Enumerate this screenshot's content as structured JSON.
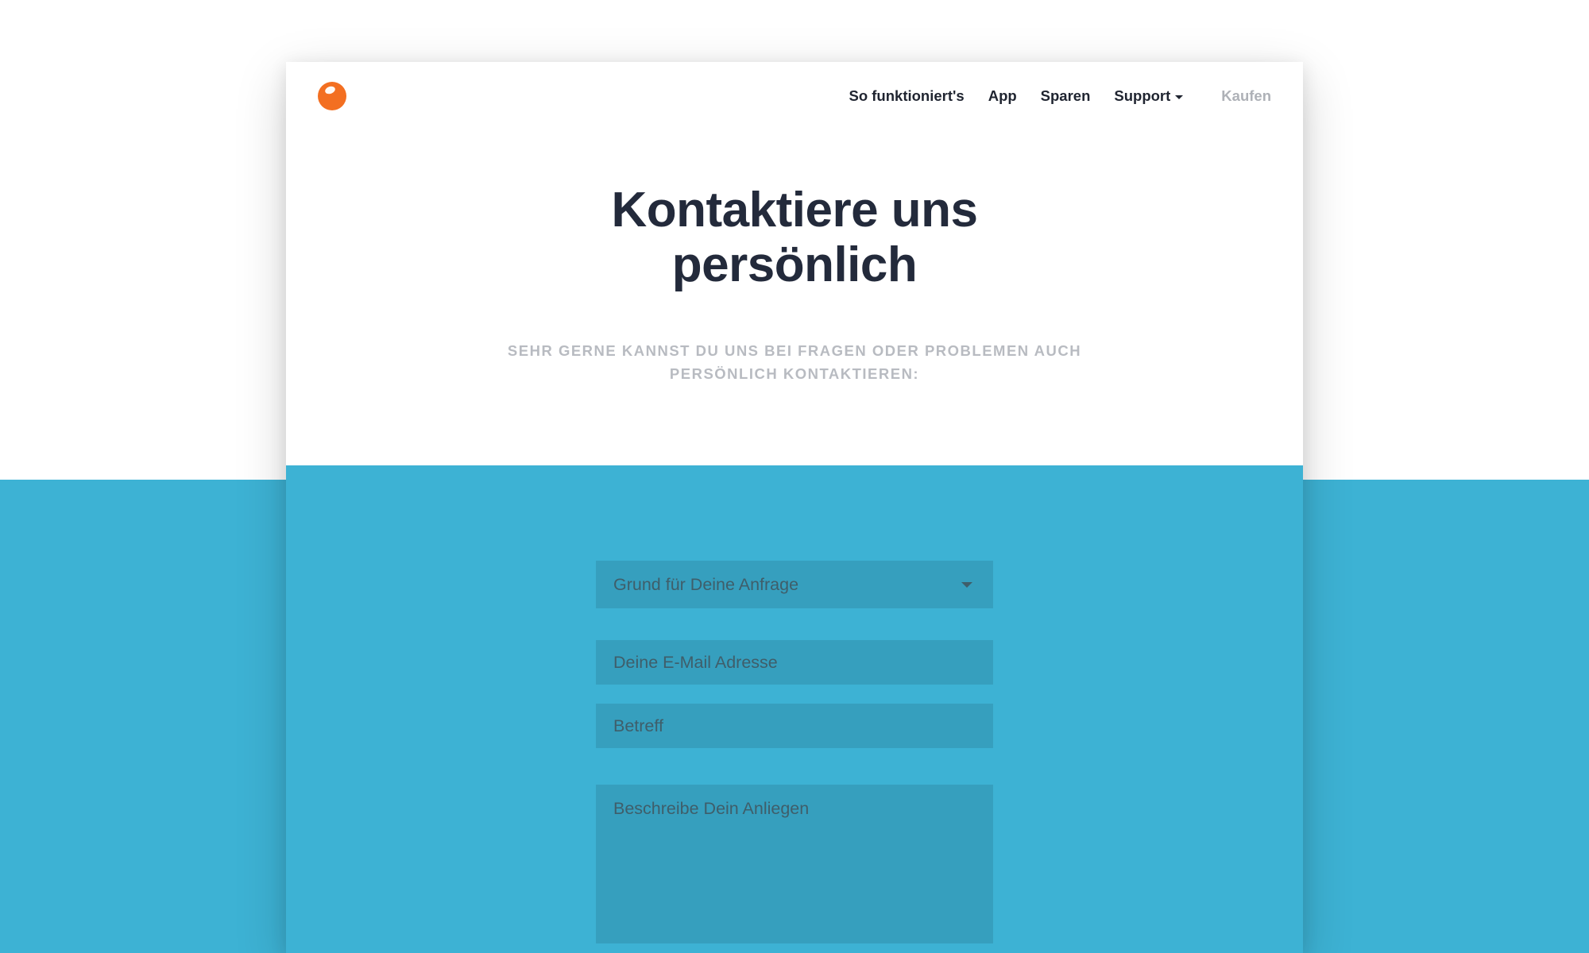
{
  "nav": {
    "items": [
      {
        "label": "So funktioniert's"
      },
      {
        "label": "App"
      },
      {
        "label": "Sparen"
      },
      {
        "label": "Support",
        "has_dropdown": true
      }
    ],
    "cta": "Kaufen"
  },
  "hero": {
    "title_line1": "Kontaktiere uns",
    "title_line2": "persönlich",
    "subtitle_line1": "SEHR GERNE KANNST DU UNS BEI FRAGEN ODER PROBLEMEN AUCH",
    "subtitle_line2": "PERSÖNLICH KONTAKTIEREN:"
  },
  "form": {
    "reason_placeholder": "Grund für Deine Anfrage",
    "email_placeholder": "Deine E-Mail Adresse",
    "subject_placeholder": "Betreff",
    "message_placeholder": "Beschreibe Dein Anliegen"
  },
  "colors": {
    "accent_orange": "#f36f21",
    "brand_blue": "#3db2d4",
    "heading": "#232a3b"
  }
}
